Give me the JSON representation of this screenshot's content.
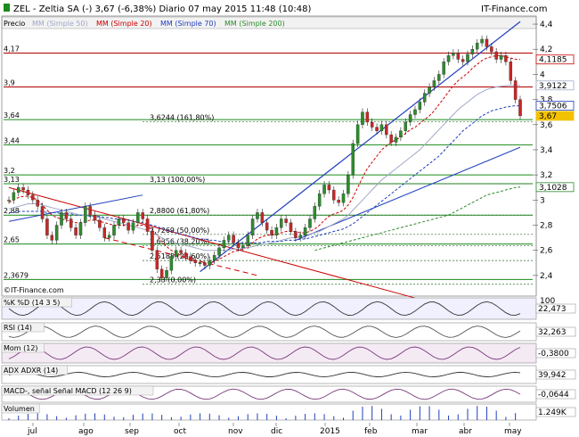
{
  "header": {
    "symbol_line": "ZEL - Zeltia SA (-)   3,67 (-6,38%)   Diario  07 may 2015 11:48 (10:48)",
    "brand": "IT-Finance.com"
  },
  "legend": {
    "price": "Precio",
    "mm50": "MM (Simple 50)",
    "mm20": "MM (Simple 20)",
    "mm70": "MM (Simple 70)",
    "mm200": "MM (Simple 200)"
  },
  "colors": {
    "price_up": "#2e8b2e",
    "price_down": "#c62828",
    "mm20": "#cc0000",
    "mm50": "#a0a8c8",
    "mm70": "#1f3fbf",
    "mm200": "#2d8a2d",
    "trend_blue": "#1f3fbf",
    "trend_red": "#cc0000",
    "level_green": "#1a8a1a",
    "level_red": "#b00000"
  },
  "chart_data": {
    "type": "line",
    "x_ticks": [
      "jul",
      "ago",
      "sep",
      "oct",
      "nov",
      "dic",
      "2015",
      "feb",
      "mar",
      "abr",
      "may"
    ],
    "ylim": [
      2.25,
      4.45
    ],
    "y_ticks": [
      "4,4",
      "4,2",
      "4",
      "3,8",
      "3,6",
      "3,4",
      "3,2",
      "3",
      "2,8",
      "2,6",
      "2,4"
    ],
    "right_tags": [
      "4,1185",
      "3,9122",
      "3,7506",
      "3,67",
      "3,1028"
    ],
    "left_levels": [
      {
        "label": "4,17",
        "value": 4.17
      },
      {
        "label": "3,9",
        "value": 3.9
      },
      {
        "label": "3,64",
        "value": 3.64
      },
      {
        "label": "3,44",
        "value": 3.44
      },
      {
        "label": "3,2",
        "value": 3.2
      },
      {
        "label": "3,13",
        "value": 3.13
      },
      {
        "label": "2,88",
        "value": 2.88
      },
      {
        "label": "2,65",
        "value": 2.65
      },
      {
        "label": "2,3679",
        "value": 2.3679
      }
    ],
    "fib_labels": [
      {
        "label": "3,6244 (161,80%)",
        "value": 3.6244
      },
      {
        "label": "3,13 (100,00%)",
        "value": 3.13
      },
      {
        "label": "2,8800 (61,80%)",
        "value": 2.88
      },
      {
        "label": "2,7269 (50,00%)",
        "value": 2.7269
      },
      {
        "label": "2,6356 (38,20%)",
        "value": 2.6356
      },
      {
        "label": "2,5188 (23,60%)",
        "value": 2.5188
      },
      {
        "label": "2,33 (0,00%)",
        "value": 2.33
      }
    ],
    "series": [
      {
        "name": "Precio",
        "values": [
          3.0,
          3.06,
          3.1,
          3.08,
          3.04,
          3.0,
          2.95,
          2.85,
          2.72,
          2.68,
          2.8,
          2.9,
          2.85,
          2.78,
          2.72,
          2.82,
          2.95,
          2.88,
          2.84,
          2.78,
          2.7,
          2.72,
          2.8,
          2.85,
          2.82,
          2.76,
          2.82,
          2.9,
          2.85,
          2.75,
          2.6,
          2.45,
          2.38,
          2.44,
          2.55,
          2.6,
          2.58,
          2.55,
          2.52,
          2.5,
          2.5,
          2.48,
          2.52,
          2.56,
          2.62,
          2.68,
          2.72,
          2.66,
          2.62,
          2.64,
          2.72,
          2.85,
          2.9,
          2.82,
          2.76,
          2.72,
          2.78,
          2.85,
          2.82,
          2.75,
          2.7,
          2.72,
          2.78,
          2.85,
          2.95,
          3.05,
          3.12,
          3.08,
          3.0,
          2.98,
          3.05,
          3.2,
          3.45,
          3.6,
          3.7,
          3.62,
          3.58,
          3.55,
          3.6,
          3.52,
          3.46,
          3.5,
          3.55,
          3.62,
          3.68,
          3.72,
          3.78,
          3.85,
          3.9,
          3.95,
          4.0,
          4.1,
          4.15,
          4.17,
          4.12,
          4.1,
          4.16,
          4.2,
          4.25,
          4.28,
          4.22,
          4.18,
          4.12,
          4.15,
          4.1,
          3.95,
          3.8,
          3.67
        ]
      },
      {
        "name": "MM (Simple 20)",
        "values": [
          2.98,
          3.0,
          3.02,
          3.03,
          3.03,
          3.02,
          3.0,
          2.96,
          2.92,
          2.88,
          2.86,
          2.85,
          2.84,
          2.83,
          2.82,
          2.82,
          2.83,
          2.84,
          2.84,
          2.83,
          2.82,
          2.81,
          2.8,
          2.8,
          2.8,
          2.79,
          2.79,
          2.8,
          2.8,
          2.79,
          2.76,
          2.72,
          2.67,
          2.63,
          2.6,
          2.58,
          2.56,
          2.54,
          2.52,
          2.51,
          2.5,
          2.5,
          2.5,
          2.51,
          2.53,
          2.55,
          2.57,
          2.59,
          2.6,
          2.61,
          2.63,
          2.66,
          2.69,
          2.71,
          2.72,
          2.72,
          2.73,
          2.74,
          2.75,
          2.75,
          2.75,
          2.74,
          2.74,
          2.75,
          2.77,
          2.8,
          2.84,
          2.87,
          2.89,
          2.9,
          2.92,
          2.96,
          3.02,
          3.1,
          3.18,
          3.25,
          3.3,
          3.35,
          3.4,
          3.43,
          3.46,
          3.48,
          3.5,
          3.53,
          3.56,
          3.58,
          3.61,
          3.64,
          3.67,
          3.71,
          3.76,
          3.81,
          3.86,
          3.91,
          3.95,
          3.98,
          4.01,
          4.05,
          4.08,
          4.11,
          4.13,
          4.14,
          4.15,
          4.15,
          4.14,
          4.13,
          4.12,
          4.1185
        ]
      },
      {
        "name": "MM (Simple 50)",
        "values": [
          2.93,
          2.94,
          2.95,
          2.96,
          2.97,
          2.97,
          2.97,
          2.96,
          2.95,
          2.94,
          2.93,
          2.92,
          2.91,
          2.9,
          2.89,
          2.88,
          2.88,
          2.87,
          2.87,
          2.86,
          2.85,
          2.84,
          2.83,
          2.82,
          2.81,
          2.8,
          2.79,
          2.78,
          2.77,
          2.76,
          2.74,
          2.72,
          2.7,
          2.68,
          2.67,
          2.66,
          2.65,
          2.64,
          2.63,
          2.62,
          2.61,
          2.6,
          2.6,
          2.6,
          2.6,
          2.6,
          2.6,
          2.61,
          2.61,
          2.62,
          2.62,
          2.63,
          2.64,
          2.65,
          2.65,
          2.66,
          2.67,
          2.68,
          2.69,
          2.7,
          2.7,
          2.71,
          2.72,
          2.73,
          2.74,
          2.75,
          2.77,
          2.79,
          2.81,
          2.83,
          2.85,
          2.88,
          2.92,
          2.96,
          3.0,
          3.04,
          3.08,
          3.12,
          3.16,
          3.19,
          3.22,
          3.25,
          3.28,
          3.31,
          3.34,
          3.37,
          3.4,
          3.44,
          3.48,
          3.52,
          3.56,
          3.6,
          3.64,
          3.68,
          3.72,
          3.75,
          3.78,
          3.81,
          3.84,
          3.86,
          3.88,
          3.89,
          3.9,
          3.905,
          3.91,
          3.912,
          3.912,
          3.9122
        ]
      },
      {
        "name": "MM (Simple 70)",
        "values": [
          2.9,
          2.9,
          2.91,
          2.91,
          2.91,
          2.91,
          2.91,
          2.91,
          2.9,
          2.9,
          2.9,
          2.89,
          2.89,
          2.89,
          2.88,
          2.88,
          2.88,
          2.87,
          2.87,
          2.87,
          2.86,
          2.86,
          2.85,
          2.85,
          2.84,
          2.84,
          2.83,
          2.83,
          2.82,
          2.81,
          2.8,
          2.79,
          2.77,
          2.76,
          2.75,
          2.74,
          2.73,
          2.72,
          2.71,
          2.7,
          2.69,
          2.69,
          2.68,
          2.68,
          2.67,
          2.67,
          2.67,
          2.66,
          2.66,
          2.66,
          2.66,
          2.66,
          2.66,
          2.66,
          2.67,
          2.67,
          2.67,
          2.67,
          2.68,
          2.68,
          2.68,
          2.69,
          2.69,
          2.7,
          2.71,
          2.72,
          2.73,
          2.74,
          2.75,
          2.76,
          2.77,
          2.79,
          2.81,
          2.84,
          2.87,
          2.9,
          2.93,
          2.96,
          2.99,
          3.02,
          3.05,
          3.08,
          3.11,
          3.14,
          3.17,
          3.2,
          3.23,
          3.26,
          3.29,
          3.32,
          3.35,
          3.39,
          3.43,
          3.47,
          3.51,
          3.55,
          3.58,
          3.61,
          3.64,
          3.67,
          3.69,
          3.71,
          3.72,
          3.73,
          3.74,
          3.745,
          3.75,
          3.7506
        ]
      },
      {
        "name": "MM (Simple 200)",
        "values": [
          null,
          null,
          null,
          null,
          null,
          null,
          null,
          null,
          null,
          null,
          null,
          null,
          null,
          null,
          null,
          null,
          null,
          null,
          null,
          null,
          null,
          null,
          null,
          null,
          null,
          null,
          null,
          null,
          null,
          null,
          null,
          null,
          null,
          null,
          null,
          null,
          null,
          null,
          null,
          null,
          null,
          null,
          null,
          null,
          null,
          null,
          null,
          null,
          null,
          null,
          null,
          null,
          null,
          null,
          null,
          null,
          null,
          null,
          null,
          null,
          null,
          null,
          null,
          null,
          2.6,
          2.61,
          2.62,
          2.63,
          2.64,
          2.65,
          2.66,
          2.67,
          2.68,
          2.69,
          2.7,
          2.71,
          2.72,
          2.73,
          2.74,
          2.75,
          2.76,
          2.77,
          2.78,
          2.79,
          2.8,
          2.81,
          2.82,
          2.83,
          2.84,
          2.85,
          2.86,
          2.87,
          2.88,
          2.9,
          2.92,
          2.94,
          2.96,
          2.98,
          3.0,
          3.02,
          3.04,
          3.05,
          3.06,
          3.07,
          3.08,
          3.09,
          3.1,
          3.1028
        ]
      }
    ],
    "indicators": [
      {
        "name": "%K %D (14 3 5)",
        "value": "22,473",
        "top_label": "100"
      },
      {
        "name": "RSI (14)",
        "value": "32,263"
      },
      {
        "name": "Mom (12)",
        "value": "-0,3800"
      },
      {
        "name": "ADX ADXR (14)",
        "value": "39,942"
      },
      {
        "name": "MACD-, señal  Señal  MACD (12 26 9)",
        "value": "-0,0644"
      },
      {
        "name": "Volumen",
        "value": "1.249K"
      }
    ]
  }
}
